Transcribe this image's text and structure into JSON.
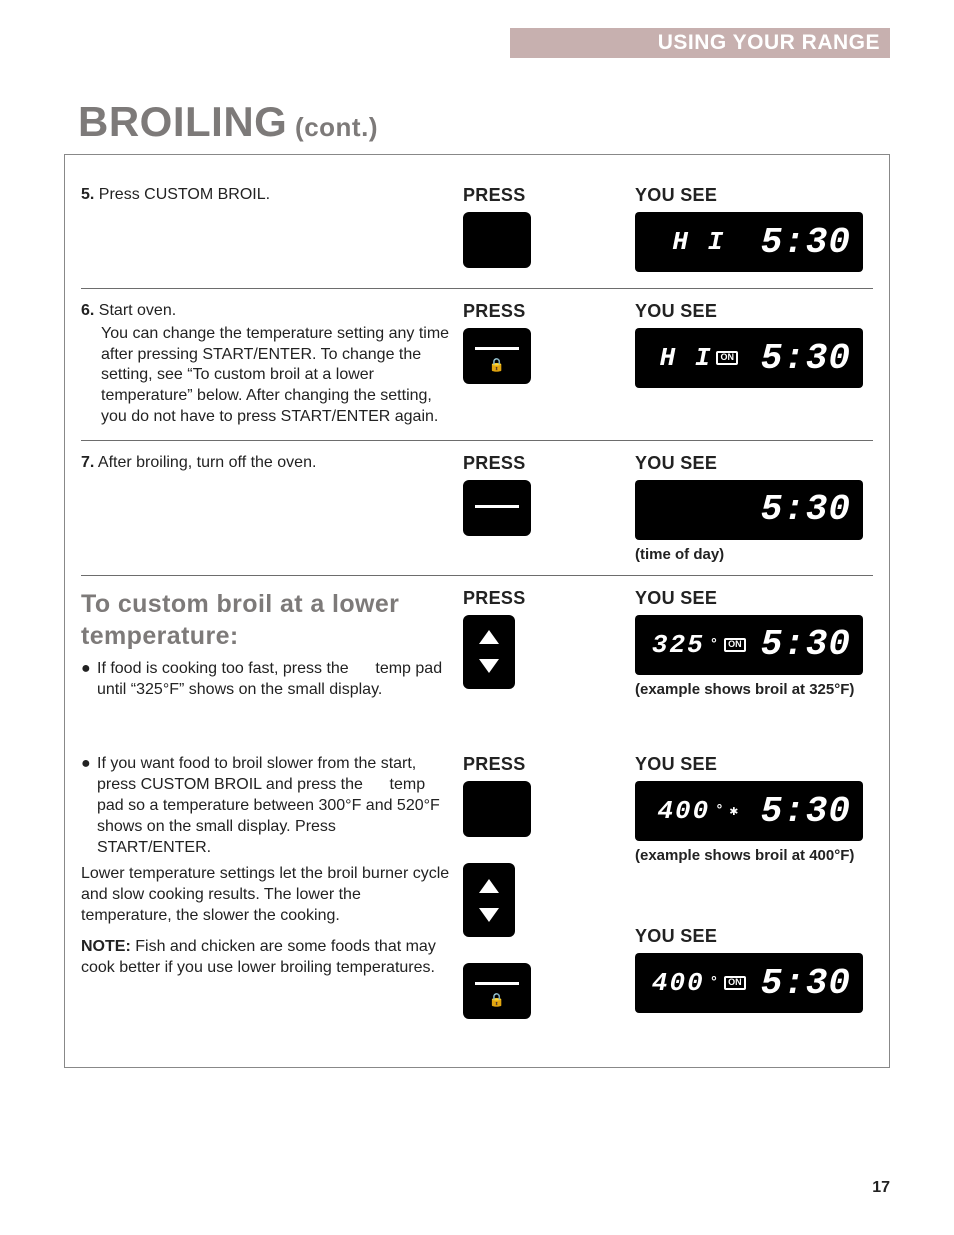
{
  "banner": {
    "label": "USING YOUR RANGE"
  },
  "title": {
    "big": "Broiling",
    "small": " (cont.)"
  },
  "column_labels": {
    "press": "PRESS",
    "you_see": "YOU SEE"
  },
  "caption": {
    "time_of_day": "(time of day)",
    "broil_325": "(example shows broil at 325°F)",
    "broil_400": "(example shows broil at 400°F)"
  },
  "icons": {
    "lock": "🔒",
    "on": "ON"
  },
  "displays": {
    "d5": {
      "small": "H I",
      "clock": "5:30"
    },
    "d6": {
      "small": "H I",
      "on": true,
      "clock": "5:30"
    },
    "d7": {
      "clock": "5:30"
    },
    "d325": {
      "small": "325",
      "deg": "°",
      "on": true,
      "clock": "5:30"
    },
    "d400a": {
      "small": "400",
      "deg": "°",
      "star": true,
      "clock": "5:30"
    },
    "d400b": {
      "small": "400",
      "deg": "°",
      "on": true,
      "clock": "5:30"
    }
  },
  "steps": {
    "s5": {
      "num": "5.",
      "text": "Press CUSTOM BROIL."
    },
    "s6": {
      "num": "6.",
      "lead": "Start oven.",
      "body": "You can change the temperature setting any time after pressing START/ENTER. To change the setting, see “To custom broil at a lower temperature” below. After changing the setting, you do not have to press START/ENTER again."
    },
    "s7": {
      "num": "7.",
      "text": "After broiling, turn off the oven."
    }
  },
  "subhead": "To custom broil at a lower temperature:",
  "custom": {
    "b1_a": "If food is cooking too fast, press the",
    "b1_b": "temp pad until “325°F” shows on the small display.",
    "b2_a": "If you want food to broil slower from the start, press CUSTOM BROIL and press the",
    "b2_b": "temp pad so a temperature between 300°F and 520°F shows on the small display. Press START/ENTER.",
    "para2": "Lower temperature settings let the broil burner cycle and slow cooking results. The lower the temperature, the slower the cooking.",
    "note_label": "NOTE:",
    "note_body": "Fish and chicken are some foods that may cook better if you use lower broiling temperatures."
  },
  "page_number": "17"
}
